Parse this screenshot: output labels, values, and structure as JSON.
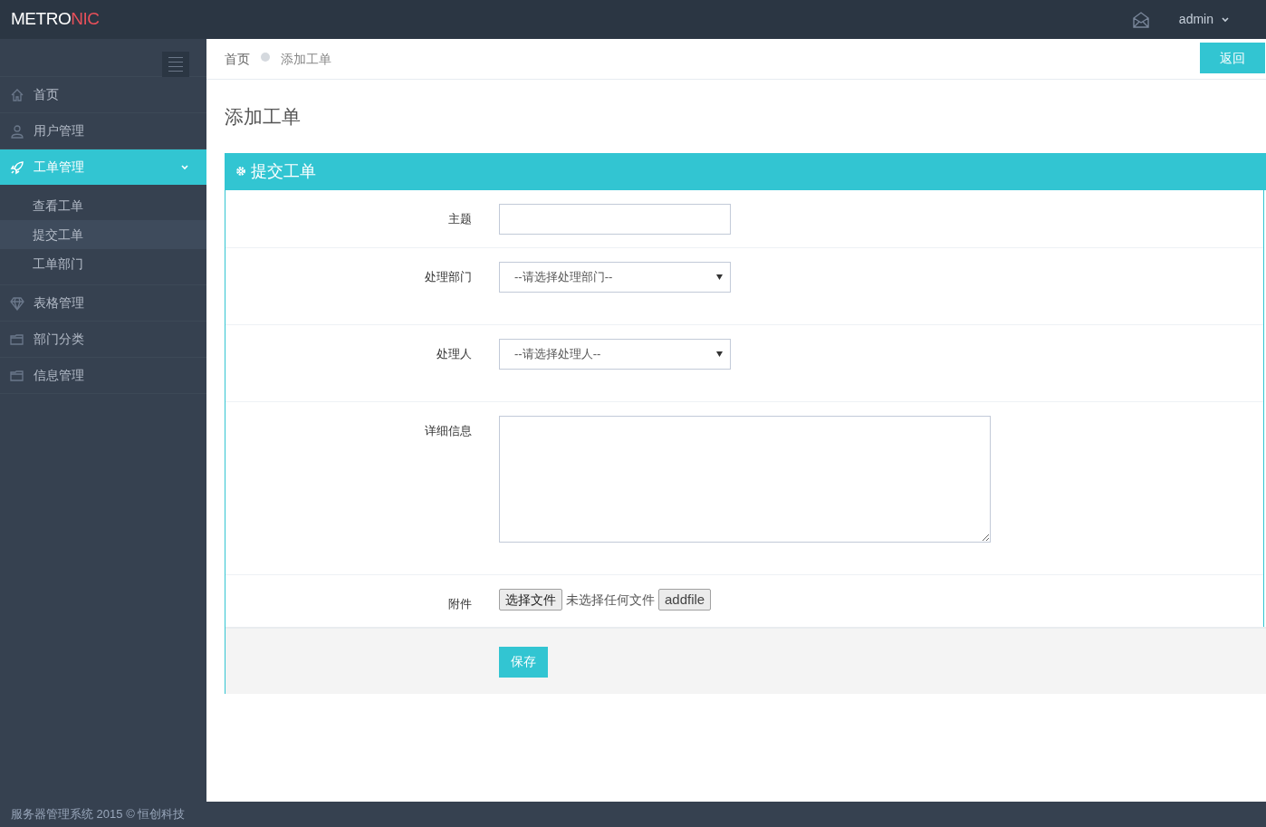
{
  "header": {
    "logo": {
      "text": "METRO",
      "accent": "NIC"
    },
    "user": "admin"
  },
  "sidebar": {
    "items": [
      {
        "label": "首页",
        "selected": false
      },
      {
        "label": "用户管理",
        "selected": false
      },
      {
        "label": "工单管理",
        "selected": true,
        "expanded": true,
        "children": [
          {
            "label": "查看工单",
            "selected": false
          },
          {
            "label": "提交工单",
            "selected": true
          },
          {
            "label": "工单部门",
            "selected": false
          }
        ]
      },
      {
        "label": "表格管理",
        "selected": false
      },
      {
        "label": "部门分类",
        "selected": false
      },
      {
        "label": "信息管理",
        "selected": false
      }
    ]
  },
  "breadcrumb": [
    "首页",
    "添加工单"
  ],
  "back_button": "返回",
  "page_title": "添加工单",
  "form": {
    "title": "提交工单",
    "rows": [
      {
        "kind": "text",
        "label": "主题"
      },
      {
        "kind": "select",
        "label": "处理部门",
        "placeholder": "--请选择处理部门--"
      },
      {
        "kind": "select",
        "label": "处理人",
        "placeholder": "--请选择处理人--"
      },
      {
        "kind": "textarea",
        "label": "详细信息"
      },
      {
        "kind": "file",
        "label": "附件",
        "button": "选择文件",
        "status": "未选择任何文件",
        "extra_button": "addfile"
      }
    ],
    "submit": "保存"
  },
  "footer": "服务器管理系统 2015 © 恒创科技"
}
